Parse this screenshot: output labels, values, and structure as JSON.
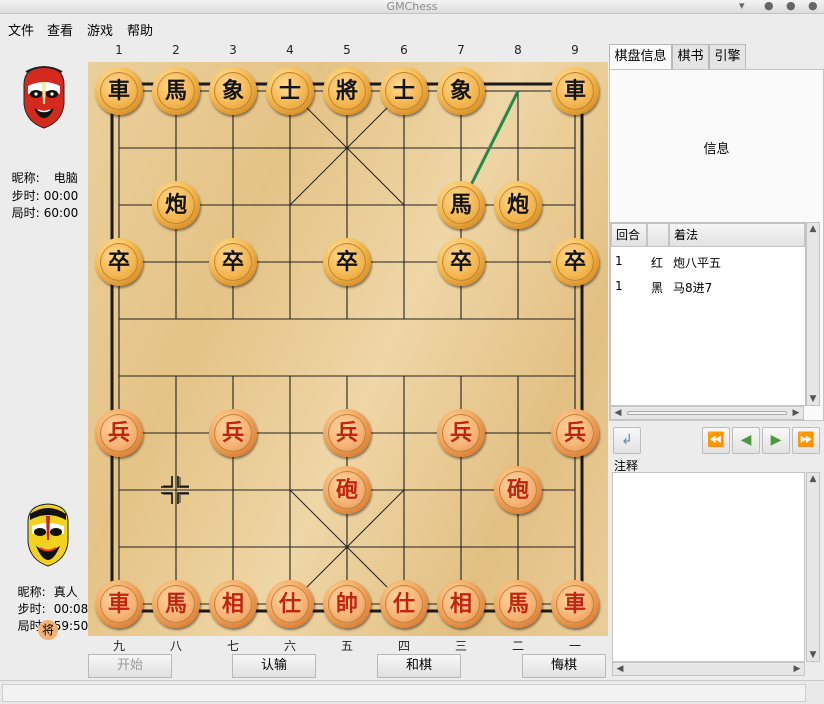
{
  "window": {
    "title": "GMChess"
  },
  "menu": [
    "文件",
    "查看",
    "游戏",
    "帮助"
  ],
  "players": {
    "top": {
      "nick_label": "昵称:",
      "nick": "电脑",
      "step_label": "步时:",
      "step_time": "00:00",
      "game_label": "局时:",
      "game_time": "60:00"
    },
    "bottom": {
      "nick_label": "昵称:",
      "nick": "真人",
      "step_label": "步时:",
      "step_time": "00:08",
      "game_label": "局时:",
      "game_time": "59:50",
      "check_badge": "将"
    }
  },
  "board": {
    "top_labels": [
      "1",
      "2",
      "3",
      "4",
      "5",
      "6",
      "7",
      "8",
      "9"
    ],
    "bottom_labels": [
      "九",
      "八",
      "七",
      "六",
      "五",
      "四",
      "三",
      "二",
      "一"
    ],
    "pieces": [
      {
        "c": "b",
        "ch": "車",
        "f": 1,
        "r": 0
      },
      {
        "c": "b",
        "ch": "馬",
        "f": 2,
        "r": 0
      },
      {
        "c": "b",
        "ch": "象",
        "f": 3,
        "r": 0
      },
      {
        "c": "b",
        "ch": "士",
        "f": 4,
        "r": 0
      },
      {
        "c": "b",
        "ch": "將",
        "f": 5,
        "r": 0
      },
      {
        "c": "b",
        "ch": "士",
        "f": 6,
        "r": 0
      },
      {
        "c": "b",
        "ch": "象",
        "f": 7,
        "r": 0
      },
      {
        "c": "b",
        "ch": "車",
        "f": 9,
        "r": 0
      },
      {
        "c": "b",
        "ch": "炮",
        "f": 2,
        "r": 2
      },
      {
        "c": "b",
        "ch": "馬",
        "f": 7,
        "r": 2
      },
      {
        "c": "b",
        "ch": "炮",
        "f": 8,
        "r": 2
      },
      {
        "c": "b",
        "ch": "卒",
        "f": 1,
        "r": 3
      },
      {
        "c": "b",
        "ch": "卒",
        "f": 3,
        "r": 3
      },
      {
        "c": "b",
        "ch": "卒",
        "f": 5,
        "r": 3
      },
      {
        "c": "b",
        "ch": "卒",
        "f": 7,
        "r": 3
      },
      {
        "c": "b",
        "ch": "卒",
        "f": 9,
        "r": 3
      },
      {
        "c": "r",
        "ch": "兵",
        "f": 1,
        "r": 6
      },
      {
        "c": "r",
        "ch": "兵",
        "f": 3,
        "r": 6
      },
      {
        "c": "r",
        "ch": "兵",
        "f": 5,
        "r": 6
      },
      {
        "c": "r",
        "ch": "兵",
        "f": 7,
        "r": 6
      },
      {
        "c": "r",
        "ch": "兵",
        "f": 9,
        "r": 6
      },
      {
        "c": "r",
        "ch": "砲",
        "f": 5,
        "r": 7
      },
      {
        "c": "r",
        "ch": "砲",
        "f": 8,
        "r": 7
      },
      {
        "c": "r",
        "ch": "車",
        "f": 1,
        "r": 9
      },
      {
        "c": "r",
        "ch": "馬",
        "f": 2,
        "r": 9
      },
      {
        "c": "r",
        "ch": "相",
        "f": 3,
        "r": 9
      },
      {
        "c": "r",
        "ch": "仕",
        "f": 4,
        "r": 9
      },
      {
        "c": "r",
        "ch": "帥",
        "f": 5,
        "r": 9
      },
      {
        "c": "r",
        "ch": "仕",
        "f": 6,
        "r": 9
      },
      {
        "c": "r",
        "ch": "相",
        "f": 7,
        "r": 9
      },
      {
        "c": "r",
        "ch": "馬",
        "f": 8,
        "r": 9
      },
      {
        "c": "r",
        "ch": "車",
        "f": 9,
        "r": 9
      }
    ],
    "last_move": {
      "from": {
        "f": 8,
        "r": 0
      },
      "to": {
        "f": 7,
        "r": 2
      },
      "color": "#1f8a4c"
    }
  },
  "buttons": {
    "start": "开始",
    "resign": "认输",
    "draw": "和棋",
    "undo": "悔棋"
  },
  "tabs": [
    {
      "label": "棋盘信息",
      "active": true
    },
    {
      "label": "棋书",
      "active": false
    },
    {
      "label": "引擎",
      "active": false
    }
  ],
  "info_title": "信息",
  "move_table": {
    "headers": [
      "回合",
      "",
      "着法"
    ],
    "rows": [
      {
        "round": "1",
        "side": "红",
        "move": "炮八平五"
      },
      {
        "round": "1",
        "side": "黑",
        "move": "马8进7"
      }
    ]
  },
  "notes_label": "注释"
}
